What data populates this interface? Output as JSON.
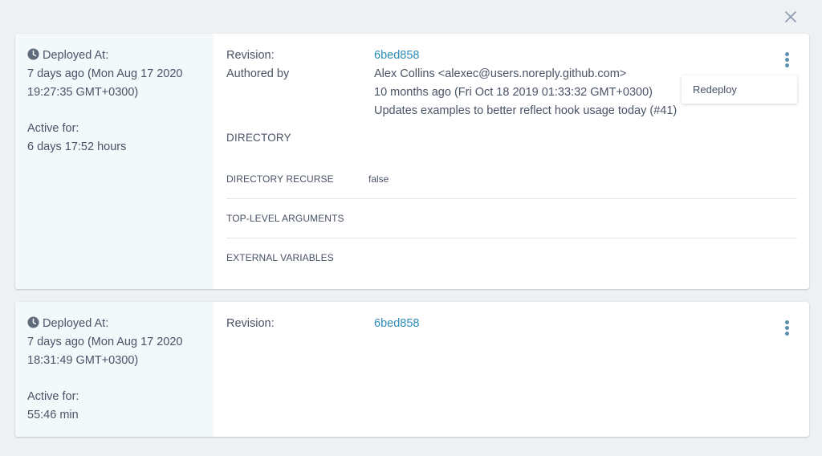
{
  "header": {
    "close_icon": "close-icon"
  },
  "deployments": [
    {
      "deployed_at_label": "Deployed At:",
      "deployed_relative": "7 days ago (Mon Aug 17 2020",
      "deployed_time": "19:27:35 GMT+0300)",
      "active_for_label": "Active for:",
      "active_for_value": "6 days 17:52 hours",
      "revision_label": "Revision:",
      "revision_value": "6bed858",
      "authored_by_label": "Authored by",
      "author": "Alex Collins <alexec@users.noreply.github.com>",
      "author_date": "10 months ago (Fri Oct 18 2019 01:33:32 GMT+0300)",
      "commit_message": "Updates examples to better reflect hook usage today (#41)",
      "directory_title": "DIRECTORY",
      "params": [
        {
          "name": "DIRECTORY RECURSE",
          "value": "false"
        },
        {
          "name": "TOP-LEVEL ARGUMENTS",
          "value": ""
        },
        {
          "name": "EXTERNAL VARIABLES",
          "value": ""
        }
      ],
      "menu": {
        "open": true,
        "items": [
          "Redeploy"
        ]
      }
    },
    {
      "deployed_at_label": "Deployed At:",
      "deployed_relative": "7 days ago (Mon Aug 17 2020",
      "deployed_time": "18:31:49 GMT+0300)",
      "active_for_label": "Active for:",
      "active_for_value": "55:46 min",
      "revision_label": "Revision:",
      "revision_value": "6bed858",
      "menu": {
        "open": false,
        "items": []
      }
    }
  ],
  "colors": {
    "background": "#eef1f4",
    "left_pane": "#f3f8fb",
    "link": "#2e8cb4",
    "kebab": "#5b8fae",
    "text": "#495366"
  }
}
